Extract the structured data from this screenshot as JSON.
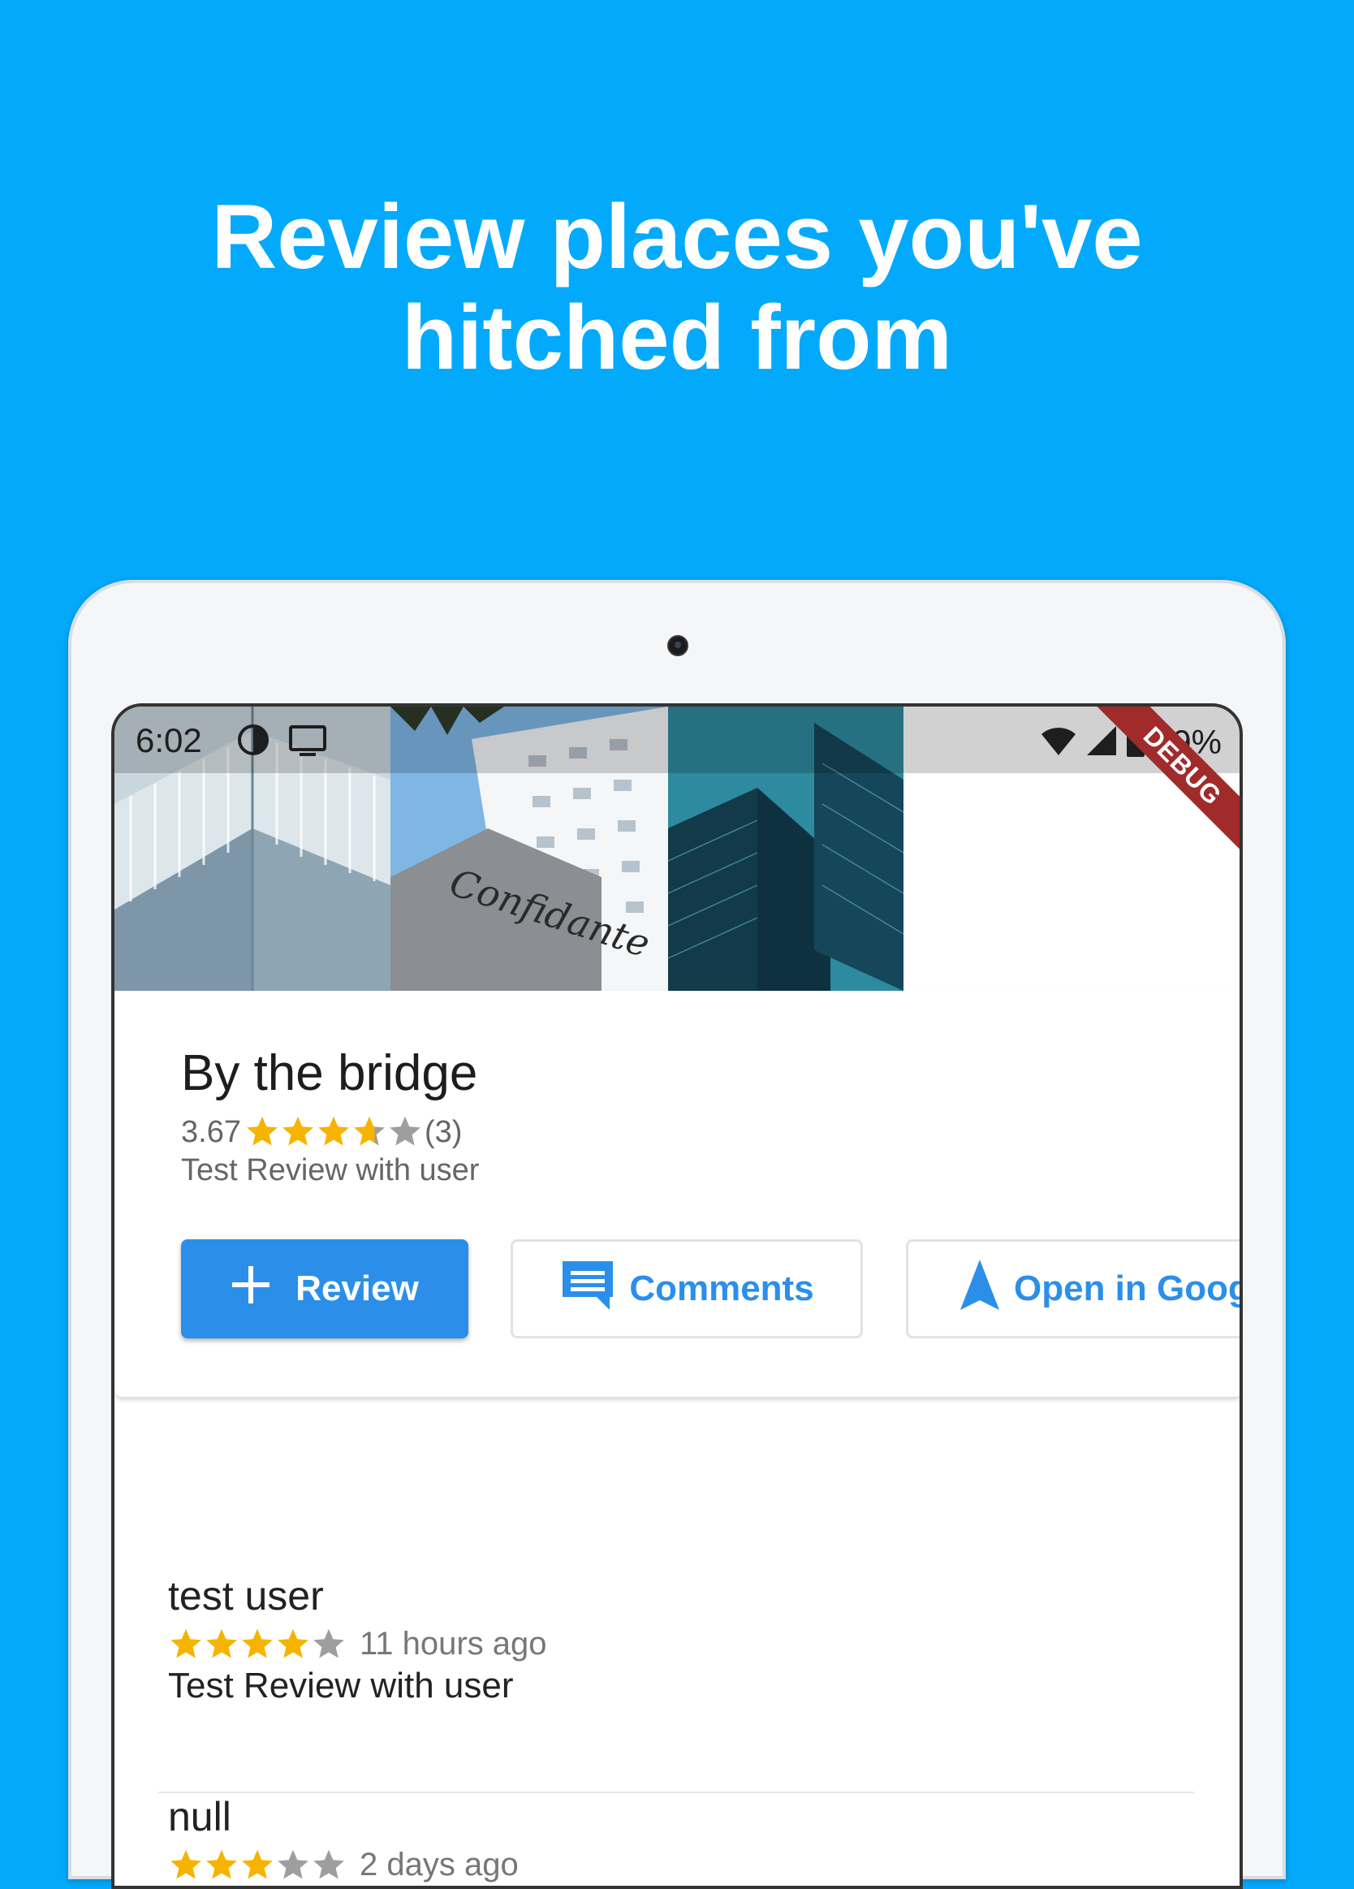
{
  "headline": {
    "line1": "Review places you've",
    "line2": "hitched from"
  },
  "status_bar": {
    "time": "6:02",
    "battery": "89%",
    "debug_banner": "DEBUG",
    "icons": [
      "brightness-icon",
      "cast-icon",
      "wifi-icon",
      "signal-icon",
      "battery-icon"
    ]
  },
  "place": {
    "title": "By the bridge",
    "rating": "3.67",
    "rating_value": 3.67,
    "review_count": "(3)",
    "subtitle": "Test Review with user"
  },
  "actions": {
    "review_label": "Review",
    "comments_label": "Comments",
    "open_label": "Open in Goog"
  },
  "reviews": [
    {
      "author": "test user",
      "stars": 4,
      "time": "11 hours ago",
      "text": "Test Review with user"
    },
    {
      "author": "null",
      "stars": 3,
      "time": "2 days ago",
      "text": ""
    }
  ],
  "colors": {
    "background": "#03AAFC",
    "accent": "#2B8FEA",
    "star_filled": "#F6B400",
    "star_empty": "#9E9E9E",
    "debug": "#A12B2B"
  }
}
